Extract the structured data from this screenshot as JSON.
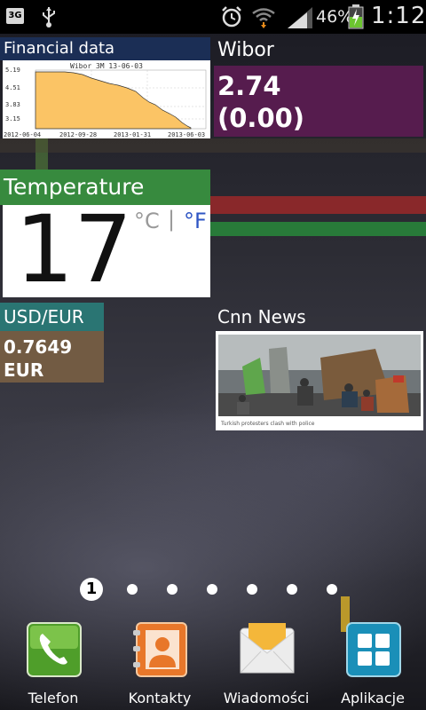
{
  "status_bar": {
    "network": "3G",
    "battery_percent": "46%",
    "time": "1:12",
    "icons": [
      "3g-icon",
      "usb-icon",
      "alarm-icon",
      "wifi-icon",
      "signal-icon",
      "battery-charging-icon"
    ]
  },
  "widgets": {
    "financial": {
      "title": "Financial data",
      "chart_label": "Wibor 3M 13-06-03",
      "y_ticks": [
        "5.19",
        "4.51",
        "3.83",
        "3.15"
      ],
      "x_ticks": [
        "2012-06-04",
        "2012-09-28",
        "2013-01-31",
        "2013-06-03"
      ]
    },
    "wibor": {
      "title": "Wibor",
      "value": "2.74",
      "change": "(0.00)"
    },
    "temperature": {
      "title": "Temperature",
      "value": "17",
      "unit_c": "°C",
      "separator": "|",
      "unit_f": "°F"
    },
    "usd_eur": {
      "title": "USD/EUR",
      "value": "0.7649",
      "currency": "EUR"
    },
    "cnn": {
      "title": "Cnn News",
      "caption": "Turkish protesters clash with police"
    }
  },
  "pages": {
    "active_label": "1",
    "count": 7
  },
  "dock": [
    {
      "label": "Telefon"
    },
    {
      "label": "Kontakty"
    },
    {
      "label": "Wiadomości"
    },
    {
      "label": "Aplikacje"
    }
  ],
  "colors": {
    "financial_title": "#1b2e55",
    "wibor_box": "#561c4e",
    "temperature_title": "#378a3e",
    "usd_title": "#2a7573",
    "usd_box": "#725b43",
    "fahrenheit": "#2e55c4"
  }
}
